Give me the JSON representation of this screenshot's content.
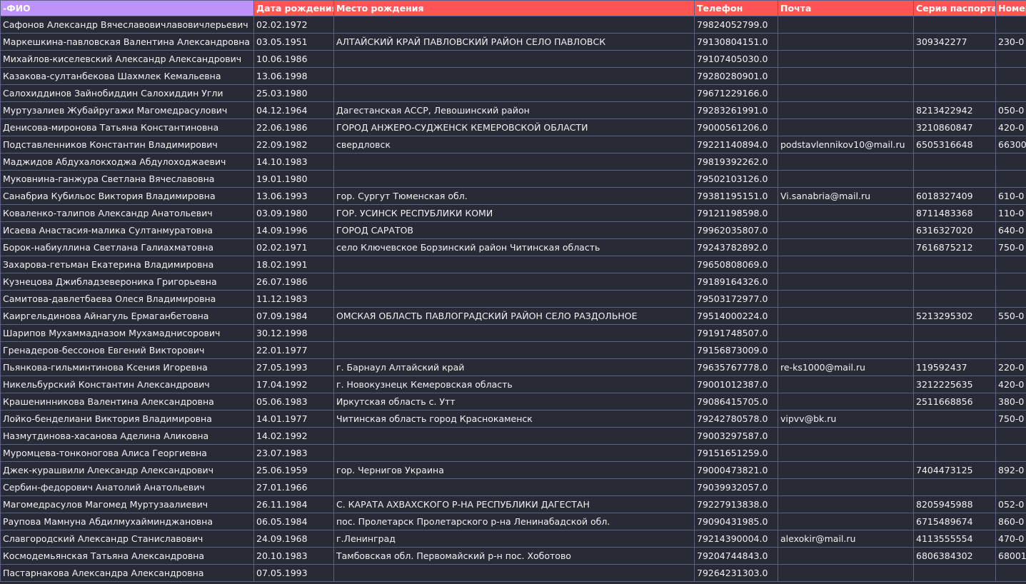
{
  "columns": [
    "-ФИО",
    "Дата рождения",
    "Место рождения",
    "Телефон",
    "Почта",
    "Серия паспорта",
    "Номер"
  ],
  "rows": [
    [
      "Сафонов Александр Вячеславовичлавовичлерьевич",
      "02.02.1972",
      "",
      "79824052799.0",
      "",
      "",
      ""
    ],
    [
      "Маркешкина-павловская Валентина Александровна",
      "03.05.1951",
      "АЛТАЙСКИЙ КРАЙ ПАВЛОВСКИЙ РАЙОН СЕЛО ПАВЛОВСК",
      "79130804151.0",
      "",
      "309342277",
      "230-0"
    ],
    [
      "Михайлов-киселевский Александр Александрович",
      "10.06.1986",
      "",
      "79107405030.0",
      "",
      "",
      ""
    ],
    [
      "Казакова-султанбекова Шахмлек Кемальевна",
      "13.06.1998",
      "",
      "79280280901.0",
      "",
      "",
      ""
    ],
    [
      "Салохиддинов Зайнобиддин Салохиддин Угли",
      "25.03.1980",
      "",
      "79671229166.0",
      "",
      "",
      ""
    ],
    [
      "Муртузалиев Жубайругажи Магомедрасулович",
      "04.12.1964",
      "Дагестанская АССР, Левошинский район",
      "79283261991.0",
      "",
      "8213422942",
      "050-0"
    ],
    [
      "Денисова-миронова Татьяна Константиновна",
      "22.06.1986",
      "ГОРОД АНЖЕРО-СУДЖЕНСК КЕМЕРОВСКОЙ ОБЛАСТИ",
      "79000561206.0",
      "",
      "3210860847",
      "420-0"
    ],
    [
      "Подставленников Константин Владимирович",
      "22.09.1982",
      "свердловск",
      "79221140894.0",
      "podstavlennikov10@mail.ru",
      "6505316648",
      "66300"
    ],
    [
      "Маджидов Абдухалокходжа Абдулоходжаевич",
      "14.10.1983",
      "",
      "79819392262.0",
      "",
      "",
      ""
    ],
    [
      "Муковнина-ганжура Светлана Вячеславовна",
      "19.01.1980",
      "",
      "79502103126.0",
      "",
      "",
      ""
    ],
    [
      "Санабриа Кубильос Виктория Владимировна",
      "13.06.1993",
      "гор. Сургут Тюменская обл.",
      "79381195151.0",
      "Vi.sanabria@mail.ru",
      "6018327409",
      "610-0"
    ],
    [
      "Коваленко-талипов Александр Анатольевич",
      "03.09.1980",
      "ГОР. УСИНСК РЕСПУБЛИКИ КОМИ",
      "79121198598.0",
      "",
      "8711483368",
      "110-0"
    ],
    [
      "Исаева Анастасия-малика Султанмуратовна",
      "14.09.1996",
      "ГОРОД САРАТОВ",
      "79962035807.0",
      "",
      "6316327020",
      "640-0"
    ],
    [
      "Борок-набиуллина Светлана Галиахматовна",
      "02.02.1971",
      "село Ключевское Борзинский район Читинская область",
      "79243782892.0",
      "",
      "7616875212",
      "750-0"
    ],
    [
      "Захарова-гетьман Екатерина Владимировна",
      "18.02.1991",
      "",
      "79650808069.0",
      "",
      "",
      ""
    ],
    [
      "Кузнецова Джибладзевероника Григорьевна",
      "26.07.1986",
      "",
      "79189164326.0",
      "",
      "",
      ""
    ],
    [
      "Самитова-давлетбаева Олеся Владимировна",
      "11.12.1983",
      "",
      "79503172977.0",
      "",
      "",
      ""
    ],
    [
      "Каиргельдинова Айнагуль Ермаганбетовна",
      "07.09.1984",
      "ОМСКАЯ ОБЛАСТЬ ПАВЛОГРАДСКИЙ РАЙОН СЕЛО РАЗДОЛЬНОЕ",
      "79514000224.0",
      "",
      "5213295302",
      "550-0"
    ],
    [
      "Шарипов Мухаммадназом Мухамаднисорович",
      "30.12.1998",
      "",
      "79191748507.0",
      "",
      "",
      ""
    ],
    [
      "Гренадеров-бессонов Евгений Викторович",
      "22.01.1977",
      "",
      "79156873009.0",
      "",
      "",
      ""
    ],
    [
      "Пьянкова-гильминтинова Ксения Игоревна",
      "27.05.1993",
      "г. Барнаул Алтайский край",
      "79635767778.0",
      "re-ks1000@mail.ru",
      "119592437",
      "220-0"
    ],
    [
      "Никельбурский Константин Александрович",
      "17.04.1992",
      "г. Новокузнецк Кемеровская область",
      "79001012387.0",
      "",
      "3212225635",
      "420-0"
    ],
    [
      "Крашенинникова Валентина Александровна",
      "05.06.1983",
      "Иркутская область с. Утт",
      "79086415705.0",
      "",
      "2511668856",
      "380-0"
    ],
    [
      "Лойко-бенделиани Виктория Владимировна",
      "14.01.1977",
      "Читинская область город Краснокаменск",
      "79242780578.0",
      "vipvv@bk.ru",
      "",
      "750-0"
    ],
    [
      "Назмутдинова-хасанова Аделина Аликовна",
      "14.02.1992",
      "",
      "79003297587.0",
      "",
      "",
      ""
    ],
    [
      "Муромцева-тонконогова Алиса Георгиевна",
      "23.07.1983",
      "",
      "79151651259.0",
      "",
      "",
      ""
    ],
    [
      "Джек-курашвили Александр Александрович",
      "25.06.1959",
      "гор. Чернигов Украина",
      "79000473821.0",
      "",
      "7404473125",
      "892-0"
    ],
    [
      "Сербин-федорович Анатолий Анатольевич",
      "27.01.1966",
      "",
      "79039932057.0",
      "",
      "",
      ""
    ],
    [
      "Магомедрасулов Магомед Муртузаалиевич",
      "26.11.1984",
      "С. КАРАТА АХВАХСКОГО Р-НА РЕСПУБЛИКИ ДАГЕСТАН",
      "79227913838.0",
      "",
      "8205945988",
      "052-0"
    ],
    [
      "Раупова Мамнуна Абдилмухайминджановна",
      "06.05.1984",
      "пос. Пролетарск Пролетарского р-на Ленинабадской обл.",
      "79090431985.0",
      "",
      "6715489674",
      "860-0"
    ],
    [
      "Славгородский Александр Станиславович",
      "24.09.1968",
      "г.Ленинград",
      "79214390004.0",
      "alexokir@mail.ru",
      "4113555554",
      "470-0"
    ],
    [
      "Космодемьянская Татьяна Александровна",
      "20.10.1983",
      "Тамбовская обл. Первомайский р-н пос. Хоботово",
      "79204744843.0",
      "",
      "6806384302",
      "68001"
    ],
    [
      "Пастарнакова Александра Александровна",
      "07.05.1993",
      "",
      "79264231303.0",
      "",
      "",
      ""
    ]
  ],
  "colors": {
    "background": "#282a36",
    "header_first": "#bd93f9",
    "header": "#ff5555",
    "grid": "#5c5f86",
    "text": "#f2f2f2"
  }
}
